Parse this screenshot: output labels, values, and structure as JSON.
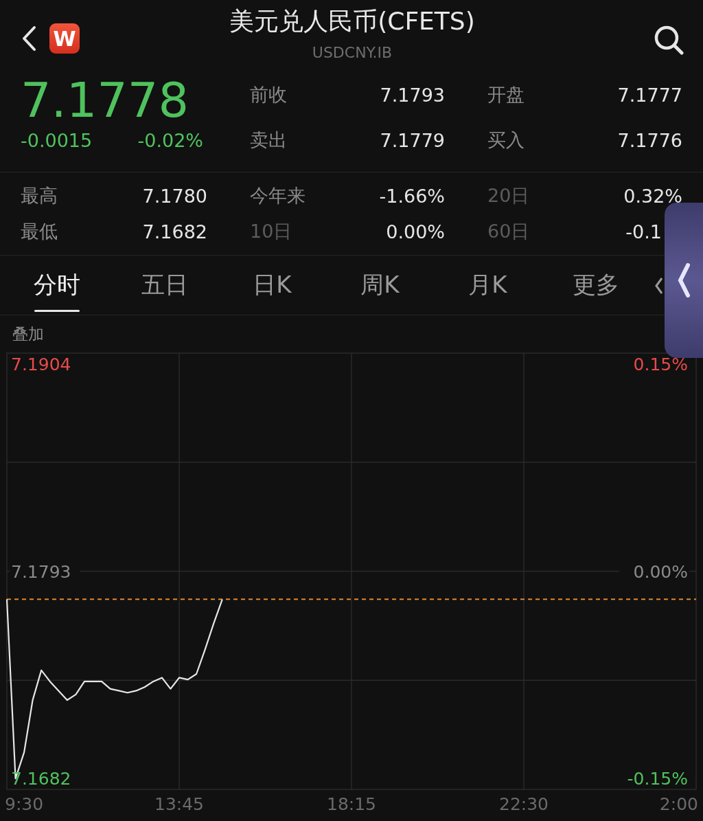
{
  "header": {
    "logo": "W",
    "title": "美元兑人民币(CFETS)",
    "code": "USDCNY.IB"
  },
  "quote": {
    "price": "7.1778",
    "change": "-0.0015",
    "change_pct": "-0.02%",
    "rows": [
      [
        {
          "label": "前收",
          "value": "7.1793"
        },
        {
          "label": "开盘",
          "value": "7.1777"
        }
      ],
      [
        {
          "label": "卖出",
          "value": "7.1779"
        },
        {
          "label": "买入",
          "value": "7.1776"
        }
      ]
    ]
  },
  "stats": [
    [
      {
        "label": "最高",
        "value": "7.1780",
        "dim": false
      },
      {
        "label": "今年来",
        "value": "-1.66%",
        "dim": false
      },
      {
        "label": "20日",
        "value": "0.32%",
        "dim": true
      }
    ],
    [
      {
        "label": "最低",
        "value": "7.1682",
        "dim": false
      },
      {
        "label": "10日",
        "value": "0.00%",
        "dim": true
      },
      {
        "label": "60日",
        "value": "-0.1",
        "dim": true
      }
    ]
  ],
  "tabs": [
    {
      "label": "分时",
      "selected": true
    },
    {
      "label": "五日",
      "selected": false
    },
    {
      "label": "日K",
      "selected": false
    },
    {
      "label": "周K",
      "selected": false
    },
    {
      "label": "月K",
      "selected": false
    },
    {
      "label": "更多",
      "selected": false
    }
  ],
  "chart": {
    "overlay_label": "叠加",
    "right_labels": [
      "0.15%",
      "0.00%",
      "-0.15%"
    ],
    "chart_data": {
      "type": "line",
      "yticks": [
        {
          "value": 7.1904,
          "label": "7.1904"
        },
        {
          "value": 7.1793,
          "label": "7.1793"
        },
        {
          "value": 7.1682,
          "label": "7.1682"
        }
      ],
      "categories": [
        null,
        null,
        "9:30",
        null,
        null,
        null,
        null,
        null,
        null,
        null,
        null,
        null,
        null,
        null,
        null,
        null,
        null,
        null,
        null,
        null,
        "13:45",
        null,
        null,
        null,
        null,
        null,
        null,
        null,
        null,
        null,
        null,
        null,
        null,
        null,
        null,
        null,
        null,
        null,
        null,
        null,
        "18:15",
        null,
        null,
        null,
        null,
        null,
        null,
        null,
        null,
        null,
        null,
        null,
        null,
        null,
        null,
        null,
        null,
        null,
        null,
        null,
        "22:30",
        null,
        null,
        null,
        null,
        null,
        null,
        null,
        null,
        null,
        null,
        null,
        null,
        null,
        null,
        null,
        null,
        null,
        "2:00",
        null,
        null
      ],
      "series": [
        {
          "color": "#e6e6e6",
          "values": [
            7.1778,
            7.1682,
            7.1696,
            7.1724,
            7.174,
            7.1734,
            7.1729,
            7.1724,
            7.1727,
            7.1734,
            7.1734,
            7.1734,
            7.173,
            7.1729,
            7.1728,
            7.1729,
            7.1731,
            7.1734,
            7.1736,
            7.173,
            7.1736,
            7.1735,
            7.1738,
            7.1751,
            7.1765,
            7.1778,
            null,
            null,
            null,
            null,
            null,
            null,
            null,
            null,
            null,
            null,
            null,
            null,
            null,
            null,
            null,
            null,
            null,
            null,
            null,
            null,
            null,
            null,
            null,
            null,
            null,
            null,
            null,
            null,
            null,
            null,
            null,
            null,
            null,
            null,
            null,
            null,
            null,
            null,
            null,
            null,
            null,
            null,
            null,
            null,
            null,
            null,
            null,
            null,
            null,
            null,
            null,
            null,
            null,
            null,
            null
          ]
        },
        {
          "color": "#e0892e",
          "line_style": "dashed",
          "values": [
            7.1778,
            7.1778,
            7.1778,
            7.1778,
            7.1778,
            7.1778,
            7.1778,
            7.1778,
            7.1778,
            7.1778,
            7.1778,
            7.1778,
            7.1778,
            7.1778,
            7.1778,
            7.1778,
            7.1778,
            7.1778,
            7.1778,
            7.1778,
            7.1778,
            7.1778,
            7.1778,
            7.1778,
            7.1778,
            7.1778,
            7.1778,
            7.1778,
            7.1778,
            7.1778,
            7.1778,
            7.1778,
            7.1778,
            7.1778,
            7.1778,
            7.1778,
            7.1778,
            7.1778,
            7.1778,
            7.1778,
            7.1778,
            7.1778,
            7.1778,
            7.1778,
            7.1778,
            7.1778,
            7.1778,
            7.1778,
            7.1778,
            7.1778,
            7.1778,
            7.1778,
            7.1778,
            7.1778,
            7.1778,
            7.1778,
            7.1778,
            7.1778,
            7.1778,
            7.1778,
            7.1778,
            7.1778,
            7.1778,
            7.1778,
            7.1778,
            7.1778,
            7.1778,
            7.1778,
            7.1778,
            7.1778,
            7.1778,
            7.1778,
            7.1778,
            7.1778,
            7.1778,
            7.1778,
            7.1778,
            7.1778,
            7.1778,
            7.1778,
            7.1778
          ]
        }
      ],
      "ylim": [
        7.1676,
        7.191
      ],
      "grid": true
    }
  }
}
